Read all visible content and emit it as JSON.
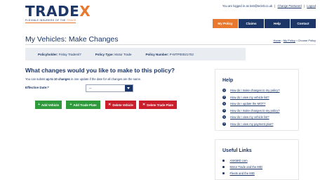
{
  "brand": {
    "name_prefix": "TRADE",
    "name_suffix": "X",
    "tagline_prefix": "FLEXIBLE INSURERS OF THE ",
    "tagline_accent": "TRADE",
    "colors": {
      "navy": "#1c3668",
      "orange": "#e9782f",
      "green": "#2f9a3c",
      "red": "#c81f2b"
    }
  },
  "account": {
    "logged_in_text": "You are logged in as test@tecktt.co.uk",
    "change_password": "Change Password",
    "logout": "Logout",
    "separator": "|"
  },
  "nav": {
    "tabs": [
      {
        "label": "My Policy",
        "active": true
      },
      {
        "label": "Claims",
        "active": false
      },
      {
        "label": "Help",
        "active": false
      },
      {
        "label": "Contact",
        "active": false
      }
    ]
  },
  "page": {
    "title": "My Vehicles: Make Changes",
    "breadcrumb": [
      "Home",
      "My Policy",
      "Choose Policy"
    ],
    "breadcrumb_sep": "›"
  },
  "policy": {
    "holder_label": "Policyholder:",
    "holder_value": "Finlay Trademl7",
    "type_label": "Policy Type:",
    "type_value": "Motor Trade",
    "number_label": "Policy Number:",
    "number_value": "P-MTP00021702"
  },
  "main": {
    "heading": "What changes would you like to make to this policy?",
    "intro_prefix": "You can submit ",
    "intro_bold": "up to 10 changes",
    "intro_suffix": " in one update if the date for all changes are the same.",
    "effective_label": "Effective Date:*",
    "effective_value": "--",
    "buttons": [
      {
        "label": "Add Vehicle",
        "icon": "+",
        "icon_name": "plus-icon",
        "color": "green"
      },
      {
        "label": "Add Trade Plate",
        "icon": "+",
        "icon_name": "plus-icon",
        "color": "green"
      },
      {
        "label": "Delete Vehicle",
        "icon": "✕",
        "icon_name": "cross-icon",
        "color": "red"
      },
      {
        "label": "Delete Trade Plate",
        "icon": "✕",
        "icon_name": "cross-icon",
        "color": "red"
      }
    ]
  },
  "help": {
    "title": "Help",
    "icon": "?",
    "icon_name": "question-icon",
    "items": [
      "How do I make changes to my policy?",
      "How do I view my vehicle list?",
      "How do I update the MOT?",
      "How do I make changes to my policy?",
      "How do I view my vehicle list?",
      "How do I view my payment plan?"
    ]
  },
  "useful_links": {
    "title": "Useful Links",
    "items": [
      "ASKMID.com",
      "Motor Trade and the MID",
      "Fleets and the MID"
    ]
  }
}
